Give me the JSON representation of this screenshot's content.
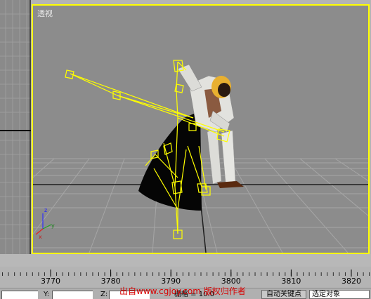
{
  "viewport": {
    "label": "透视",
    "axis_labels": {
      "x": "x",
      "y": "y",
      "z": "z"
    },
    "colors": {
      "background": "#8c8c8c",
      "border": "#ffff00",
      "grid": "#a8a8a8",
      "bones": "#ffff00"
    }
  },
  "timeline": {
    "ticks": [
      "3770",
      "3780",
      "3790",
      "3800",
      "3810",
      "3820"
    ]
  },
  "statusbar": {
    "y_label": "Y:",
    "z_label": "Z:",
    "grid_text": "栅格 = 10.0",
    "auto_key_label": "自动关键点",
    "selected_label": "选定对象"
  },
  "watermark": "出自www.cgjoy.com 版权归作者"
}
